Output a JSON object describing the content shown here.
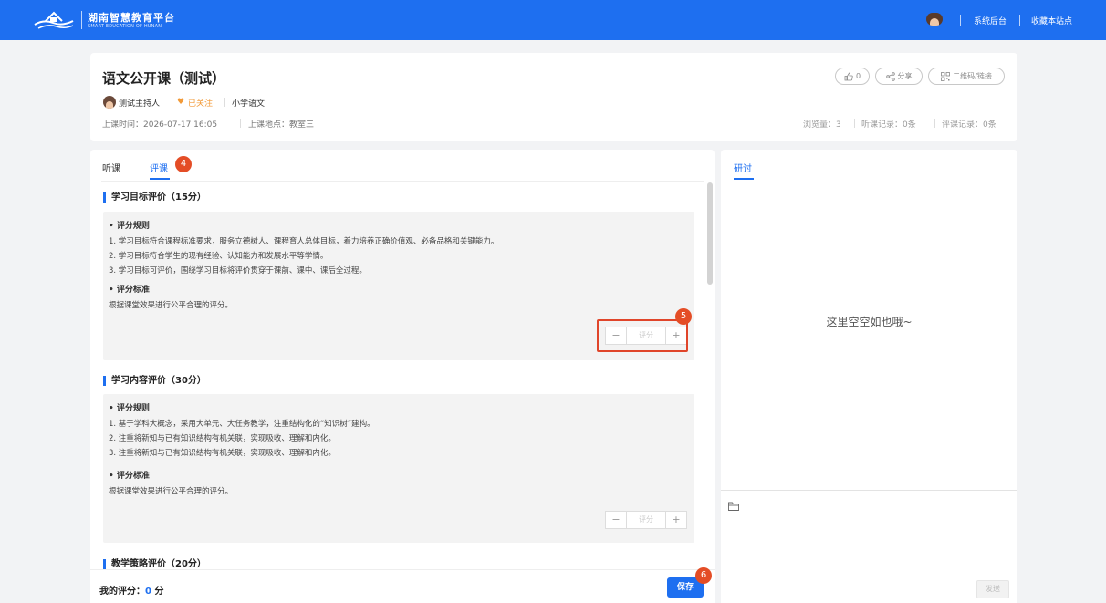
{
  "header": {
    "title": "湖南智慧教育平台",
    "subtitle": "SMART EDUCATION OF HUNAN",
    "links": [
      "系统后台",
      "收藏本站点"
    ]
  },
  "course": {
    "title": "语文公开课（测试）",
    "host": "测试主持人",
    "follow": "已关注",
    "subject": "小学语文",
    "time": "上课时间：2026-07-17 16:05",
    "location": "上课地点：教室三",
    "like_count": "0",
    "share_label": "分享",
    "qrcode_label": "二维码/链接",
    "stats": [
      "浏览量：3",
      "听课记录：0条",
      "评课记录：0条"
    ]
  },
  "tabs": {
    "listen": "听课",
    "evaluate": "评课"
  },
  "badges": {
    "tab": "4",
    "stepper": "5",
    "save": "6"
  },
  "sections": [
    {
      "title": "学习目标评价（15分）",
      "rule_head": "• 评分规则",
      "rules": [
        "1. 学习目标符合课程标准要求，服务立德树人、课程育人总体目标，着力培养正确价值观、必备品格和关键能力。",
        "2. 学习目标符合学生的现有经验、认知能力和发展水平等学情。",
        "3. 学习目标可评价，围绕学习目标将评价贯穿于课前、课中、课后全过程。"
      ],
      "std_head": "• 评分标准",
      "standard": "根据课堂效果进行公平合理的评分。",
      "score_placeholder": "评分"
    },
    {
      "title": "学习内容评价（30分）",
      "rule_head": "• 评分规则",
      "rules": [
        "1. 基于学科大概念，采用大单元、大任务教学，注重结构化的“知识树”建构。",
        "2. 注重将新知与已有知识结构有机关联，实现吸收、理解和内化。",
        "3. 注重将新知与已有知识结构有机关联，实现吸收、理解和内化。"
      ],
      "std_head": "• 评分标准",
      "standard": "根据课堂效果进行公平合理的评分。",
      "score_placeholder": "评分"
    },
    {
      "title": "教学策略评价（20分）"
    }
  ],
  "footer": {
    "my_score_label": "我的评分：",
    "my_score_value": "0",
    "my_score_unit": " 分",
    "save": "保存"
  },
  "discussion": {
    "tab": "研讨",
    "empty": "这里空空如也哦~",
    "send": "发送"
  },
  "colors": {
    "primary": "#1e6ff0",
    "badge": "#e44d26",
    "follow": "#f29a38"
  }
}
